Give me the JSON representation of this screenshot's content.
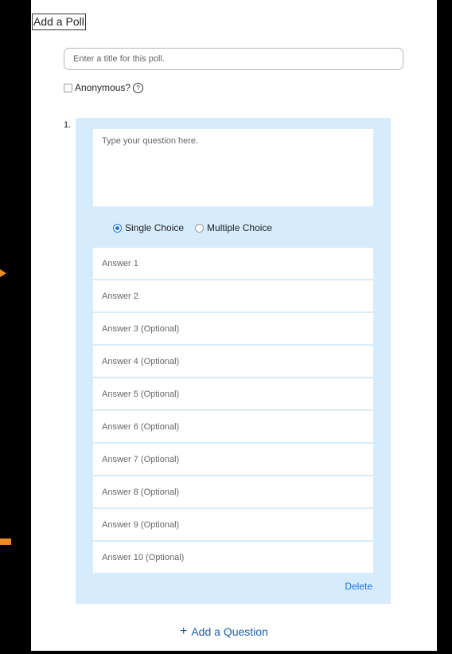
{
  "window": {
    "title": "Add a Poll"
  },
  "poll": {
    "title_placeholder": "Enter a title for this poll.",
    "anonymous_label": "Anonymous?",
    "help_glyph": "?"
  },
  "question": {
    "number": "1.",
    "text_placeholder": "Type your question here.",
    "types": [
      {
        "label": "Single Choice",
        "selected": true
      },
      {
        "label": "Multiple Choice",
        "selected": false
      }
    ],
    "answers": [
      "Answer 1",
      "Answer 2",
      "Answer 3 (Optional)",
      "Answer 4 (Optional)",
      "Answer 5 (Optional)",
      "Answer 6 (Optional)",
      "Answer 7 (Optional)",
      "Answer 8 (Optional)",
      "Answer 9 (Optional)",
      "Answer 10 (Optional)"
    ],
    "delete_label": "Delete"
  },
  "add_question": {
    "plus": "+",
    "label": "Add a Question"
  },
  "colors": {
    "accent": "#1a73e8",
    "panel_bg": "#d6ebfc",
    "annotation_arrow": "#f08a24"
  }
}
